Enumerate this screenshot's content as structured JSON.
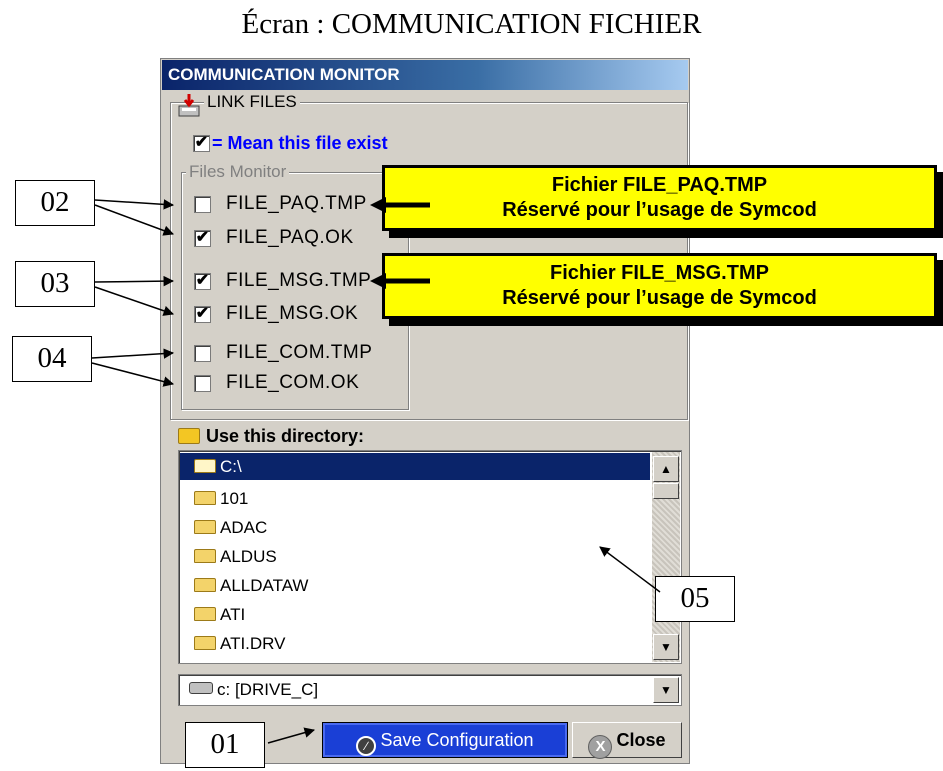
{
  "caption": "Écran : COMMUNICATION FICHIER",
  "window": {
    "title": "COMMUNICATION MONITOR",
    "link_files_label": "LINK FILES",
    "mean_text": "= Mean this file exist",
    "files_monitor_label": "Files Monitor",
    "files": [
      {
        "label": "FILE_PAQ.TMP",
        "checked": false
      },
      {
        "label": "FILE_PAQ.OK",
        "checked": true
      },
      {
        "label": "FILE_MSG.TMP",
        "checked": true
      },
      {
        "label": "FILE_MSG.OK",
        "checked": true
      },
      {
        "label": "FILE_COM.TMP",
        "checked": false
      },
      {
        "label": "FILE_COM.OK",
        "checked": false
      }
    ],
    "directory_label": "Use this directory:",
    "directories": [
      "C:\\",
      "101",
      "ADAC",
      "ALDUS",
      "ALLDATAW",
      "ATI",
      "ATI.DRV"
    ],
    "selected_directory": "C:\\",
    "drive": "c: [DRIVE_C]",
    "save_button": "Save Configuration",
    "close_button": "Close"
  },
  "callouts": {
    "paq": {
      "line1": "Fichier FILE_PAQ.TMP",
      "line2": "Réservé pour l’usage de Symcod"
    },
    "msg": {
      "line1": "Fichier FILE_MSG.TMP",
      "line2": "Réservé pour l’usage de Symcod"
    }
  },
  "labels": {
    "n01": "01",
    "n02": "02",
    "n03": "03",
    "n04": "04",
    "n05": "05"
  }
}
